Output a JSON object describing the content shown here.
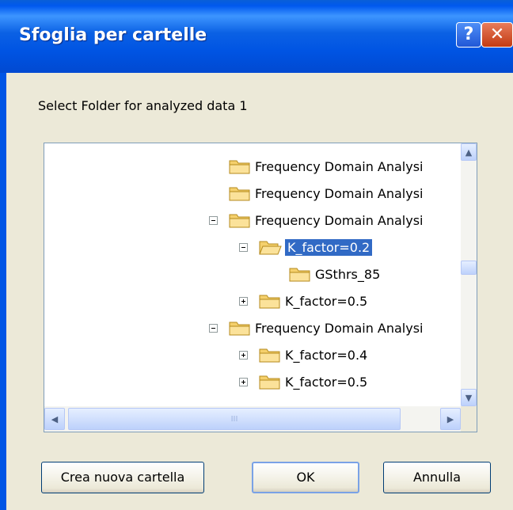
{
  "window": {
    "title": "Sfoglia per cartelle",
    "help_label": "?",
    "close_label": "✕"
  },
  "dialog": {
    "prompt": "Select Folder for analyzed data 1"
  },
  "tree": {
    "nodes": [
      {
        "label": "Frequency Domain Analysi",
        "expander": "none",
        "selected": false
      },
      {
        "label": "Frequency Domain Analysi",
        "expander": "none",
        "selected": false
      },
      {
        "label": "Frequency Domain Analysi",
        "expander": "minus",
        "selected": false
      },
      {
        "label": "K_factor=0.2",
        "expander": "minus",
        "selected": true,
        "open": true
      },
      {
        "label": "GSthrs_85",
        "expander": "none",
        "selected": false
      },
      {
        "label": "K_factor=0.5",
        "expander": "plus",
        "selected": false
      },
      {
        "label": "Frequency Domain Analysi",
        "expander": "minus",
        "selected": false
      },
      {
        "label": "K_factor=0.4",
        "expander": "plus",
        "selected": false
      },
      {
        "label": "K_factor=0.5",
        "expander": "plus",
        "selected": false
      }
    ]
  },
  "scrollbar": {
    "up_icon": "▲",
    "down_icon": "▼",
    "left_icon": "◀",
    "right_icon": "▶",
    "grip": "III"
  },
  "buttons": {
    "new_folder": "Crea nuova cartella",
    "ok": "OK",
    "cancel": "Annulla"
  },
  "colors": {
    "titlebar": "#0054e3",
    "selection": "#316ac5",
    "folder": "#f5d06c"
  }
}
